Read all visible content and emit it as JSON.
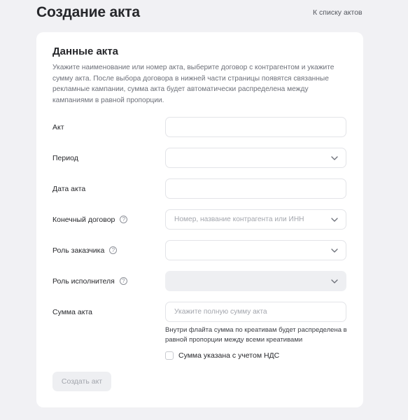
{
  "header": {
    "title": "Создание акта",
    "back_link": "К списку актов"
  },
  "form": {
    "section_title": "Данные акта",
    "description": "Укажите наименование или номер акта, выберите договор с контрагентом и укажите сумму акта. После выбора договора в нижней части страницы появятся связанные рекламные кампании, сумма акта будет автоматически распределена между кампаниями в равной пропорции.",
    "fields": {
      "act": {
        "label": "Акт",
        "value": "",
        "placeholder": ""
      },
      "period": {
        "label": "Период",
        "value": "",
        "icon": "chevron-down-icon"
      },
      "act_date": {
        "label": "Дата акта",
        "value": ""
      },
      "contract": {
        "label": "Конечный договор",
        "help_icon": "question-icon",
        "placeholder": "Номер, название контрагента или ИНН",
        "icon": "chevron-down-icon"
      },
      "customer_role": {
        "label": "Роль заказчика",
        "help_icon": "question-icon",
        "value": "",
        "icon": "chevron-down-icon"
      },
      "executor_role": {
        "label": "Роль исполнителя",
        "help_icon": "question-icon",
        "value": "",
        "disabled": true,
        "icon": "chevron-down-icon"
      },
      "amount": {
        "label": "Сумма акта",
        "placeholder": "Укажите полную сумму акта"
      }
    },
    "amount_hint": "Внутри флайта сумма по креативам будет распределена в равной пропорции между всеми креативами",
    "vat_checkbox": {
      "label": "Сумма указана с учетом НДС",
      "checked": false
    },
    "submit_label": "Создать акт"
  },
  "colors": {
    "background": "#f1f1f4",
    "card": "#ffffff",
    "field_border": "#e3e4e8",
    "disabled": "#eeeff2"
  }
}
